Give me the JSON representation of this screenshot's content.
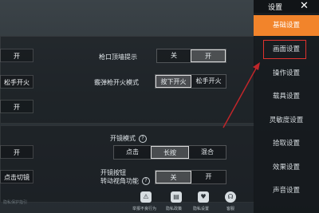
{
  "sidebar": {
    "title": "设置",
    "close": "✕",
    "tabs": [
      {
        "label": "基础设置",
        "active": true
      },
      {
        "label": "画面设置",
        "active": false
      },
      {
        "label": "操作设置",
        "active": false
      },
      {
        "label": "载具设置",
        "active": false
      },
      {
        "label": "灵敏度设置",
        "active": false
      },
      {
        "label": "拾取设置",
        "active": false
      },
      {
        "label": "效果设置",
        "active": false
      },
      {
        "label": "声音设置",
        "active": false
      }
    ]
  },
  "panel1": {
    "left_btn_kai": "开",
    "left_btn_songshou": "松手开火",
    "left_btn_kai2": "开",
    "muzzle_hint": {
      "label": "枪口顶墙提示",
      "off": "关",
      "on": "开"
    },
    "shotgun_mode": {
      "label": "霰弹枪开火模式",
      "press": "按下开火",
      "release": "松手开火"
    }
  },
  "panel2": {
    "scope_mode": {
      "label": "开镜模式",
      "help": "?",
      "tap": "点击",
      "hold": "长按",
      "mixed": "混合"
    },
    "left_btn_kai": "开",
    "left_btn_click": "点击切镜",
    "scope_rotate": {
      "label_line1": "开镜按钮",
      "label_line2": "转动视角功能",
      "help": "?",
      "off": "关",
      "on": "开"
    }
  },
  "bottom": {
    "items": [
      {
        "icon": "⚠",
        "label": "举报不良行为"
      },
      {
        "icon": "▤",
        "label": "隐私政策"
      },
      {
        "icon": "♥",
        "label": "隐私设置"
      },
      {
        "icon": "☊",
        "label": "客服"
      }
    ]
  },
  "hint": "隐私保护指引"
}
